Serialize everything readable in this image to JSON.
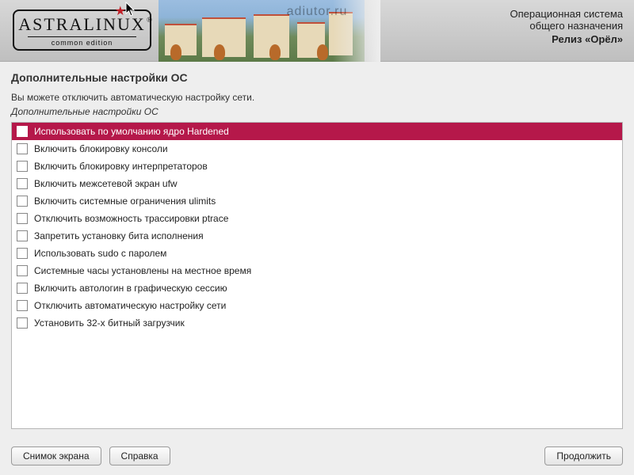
{
  "watermark": "adiutor.ru",
  "logo": {
    "main": "Astralinux",
    "sub": "common edition"
  },
  "header_right": {
    "l1": "Операционная система",
    "l2": "общего назначения",
    "l3": "Релиз «Орёл»"
  },
  "title": "Дополнительные настройки ОС",
  "subtitle": "Вы можете отключить автоматическую настройку сети.",
  "section_label": "Дополнительные настройки ОС",
  "options": [
    {
      "label": "Использовать по умолчанию ядро Hardened",
      "selected": true
    },
    {
      "label": "Включить блокировку консоли",
      "selected": false
    },
    {
      "label": "Включить блокировку интерпретаторов",
      "selected": false
    },
    {
      "label": "Включить межсетевой экран ufw",
      "selected": false
    },
    {
      "label": "Включить системные ограничения ulimits",
      "selected": false
    },
    {
      "label": "Отключить возможность трассировки ptrace",
      "selected": false
    },
    {
      "label": "Запретить установку бита исполнения",
      "selected": false
    },
    {
      "label": "Использовать sudo с паролем",
      "selected": false
    },
    {
      "label": "Системные часы установлены на местное время",
      "selected": false
    },
    {
      "label": "Включить автологин в графическую сессию",
      "selected": false
    },
    {
      "label": "Отключить автоматическую настройку сети",
      "selected": false
    },
    {
      "label": "Установить 32-х битный загрузчик",
      "selected": false
    }
  ],
  "buttons": {
    "screenshot": "Снимок экрана",
    "help": "Справка",
    "continue": "Продолжить"
  }
}
